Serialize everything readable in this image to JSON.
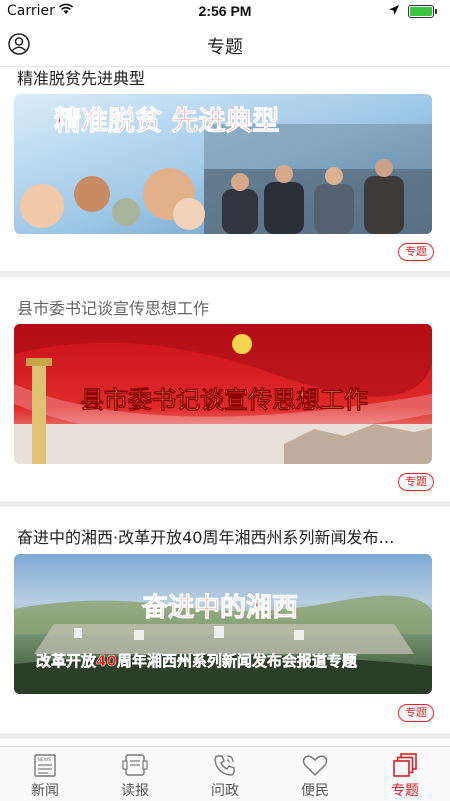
{
  "status_bar": {
    "carrier": "Carrier",
    "time": "2:56 PM",
    "battery_color": "#3cc640"
  },
  "nav": {
    "title": "专题",
    "profile_icon": "user-circle-icon"
  },
  "cards": [
    {
      "title": "精准脱贫先进典型",
      "banner_text": "精准脱贫 先进典型",
      "tag": "专题"
    },
    {
      "title": "县市委书记谈宣传思想工作",
      "banner_text": "县市委书记谈宣传思想工作",
      "tag": "专题"
    },
    {
      "title": "奋进中的湘西·改革开放40周年湘西州系列新闻发布…",
      "banner_text": "奋进中的湘西",
      "banner_subtext": "改革开放40周年湘西州系列新闻发布会报道专题",
      "tag": "专题"
    }
  ],
  "tabbar": {
    "accent": "#d81e2a",
    "tabs": [
      {
        "label": "新闻",
        "icon": "newspaper-icon"
      },
      {
        "label": "读报",
        "icon": "reader-icon"
      },
      {
        "label": "问政",
        "icon": "phone-chat-icon"
      },
      {
        "label": "便民",
        "icon": "heart-icon"
      },
      {
        "label": "专题",
        "icon": "stacked-pages-icon",
        "active": true
      }
    ]
  }
}
